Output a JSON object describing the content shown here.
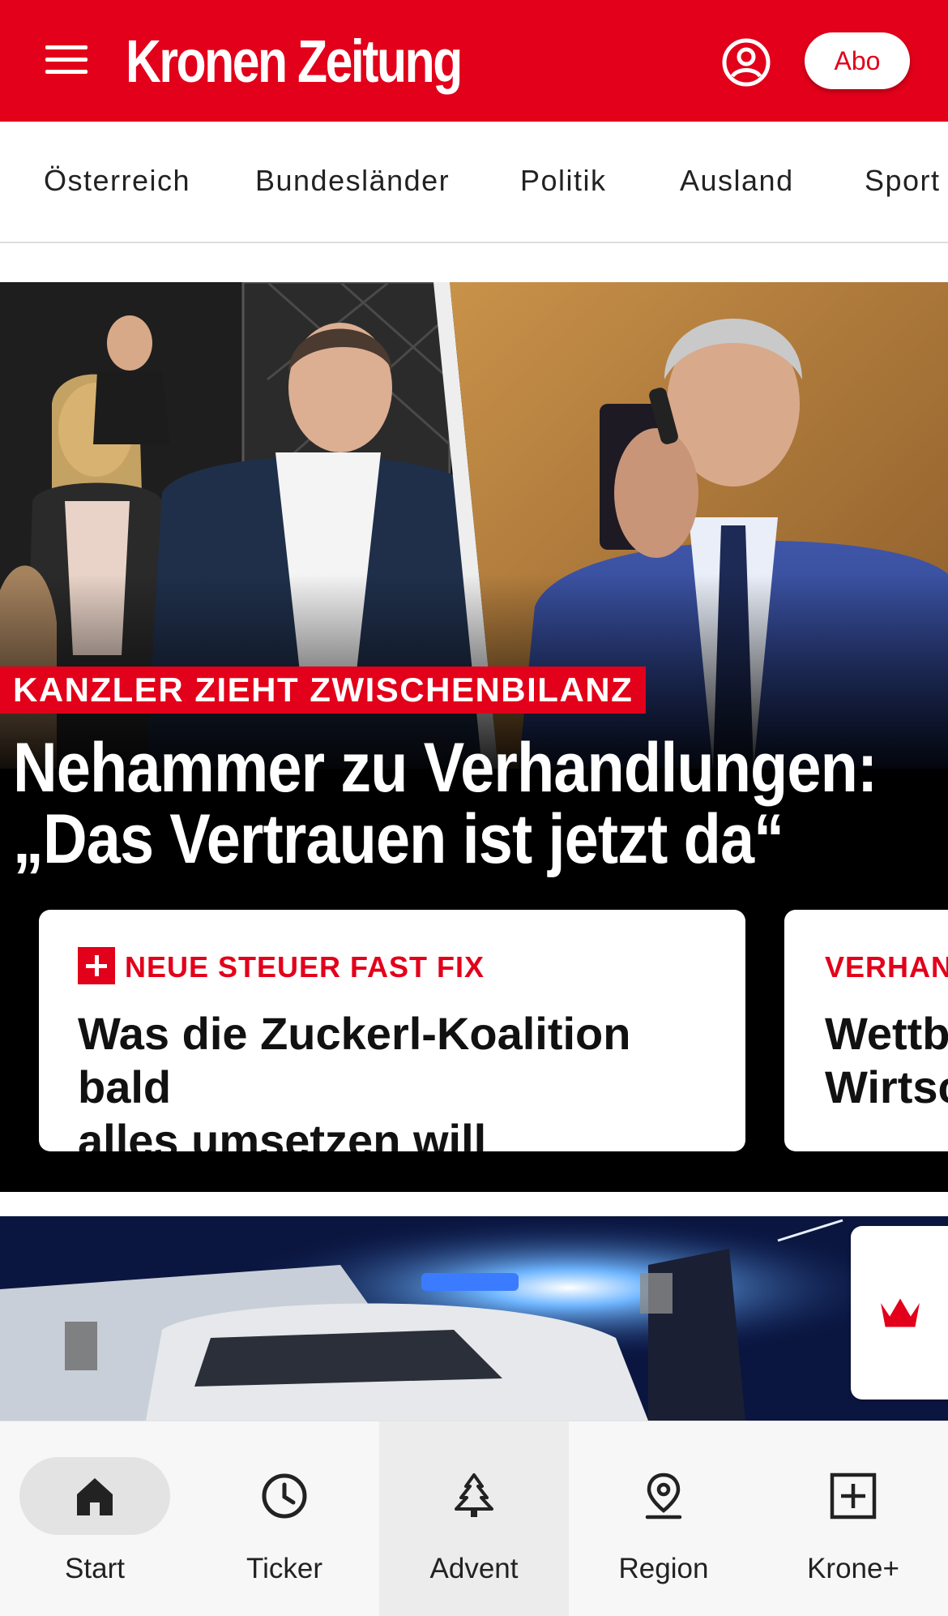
{
  "header": {
    "logo": "Kronen Zeitung",
    "abo_label": "Abo",
    "accent_color": "#e2001a",
    "icons": [
      "menu-icon",
      "account-icon"
    ]
  },
  "nav": {
    "items": [
      "Österreich",
      "Bundesländer",
      "Politik",
      "Ausland",
      "Sport"
    ]
  },
  "hero": {
    "kicker": "KANZLER ZIEHT ZWISCHENBILANZ",
    "headline_line1": "Nehammer zu Verhandlungen:",
    "headline_line2": "„Das Vertrauen ist jetzt da“",
    "cards": [
      {
        "kicker": "NEUE STEUER FAST FIX",
        "title": "Was die Zuckerl-Koalition bald\nalles umsetzen will",
        "premium": true
      },
      {
        "kicker": "VERHANI",
        "title": "Wettbe\nWirtsc"
      }
    ]
  },
  "story2": {
    "badge_icon": "crown-icon"
  },
  "tabbar": {
    "tabs": [
      {
        "label": "Start",
        "icon": "home-icon"
      },
      {
        "label": "Ticker",
        "icon": "clock-icon"
      },
      {
        "label": "Advent",
        "icon": "tree-icon"
      },
      {
        "label": "Region",
        "icon": "location-pin-icon"
      },
      {
        "label": "Krone+",
        "icon": "plus-box-icon"
      }
    ]
  }
}
